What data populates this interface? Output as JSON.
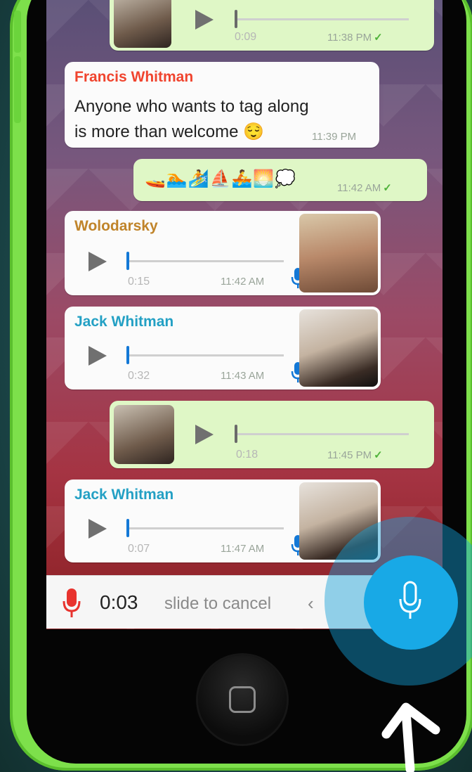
{
  "messages": [
    {
      "type": "voice",
      "direction": "out",
      "duration": "0:09",
      "time": "11:38 PM",
      "status": "✓"
    },
    {
      "type": "text",
      "direction": "in",
      "sender": "Francis Whitman",
      "sender_color": "#f0442e",
      "text_line1": "Anyone who wants to tag along",
      "text_line2": "is more than welcome 😌",
      "time": "11:39 PM"
    },
    {
      "type": "emoji",
      "direction": "out",
      "text": "🚤🏊🏄⛵🚣🌅💭",
      "time": "11:42 AM",
      "status": "✓"
    },
    {
      "type": "voice",
      "direction": "in",
      "sender": "Wolodarsky",
      "sender_color": "#c0842a",
      "duration": "0:15",
      "time": "11:42 AM"
    },
    {
      "type": "voice",
      "direction": "in",
      "sender": "Jack Whitman",
      "sender_color": "#23a0c4",
      "duration": "0:32",
      "time": "11:43 AM"
    },
    {
      "type": "voice",
      "direction": "out",
      "duration": "0:18",
      "time": "11:45 PM",
      "status": "✓"
    },
    {
      "type": "voice",
      "direction": "in",
      "sender": "Jack Whitman",
      "sender_color": "#23a0c4",
      "duration": "0:07",
      "time": "11:47 AM"
    }
  ],
  "recording": {
    "elapsed": "0:03",
    "hint": "slide to cancel",
    "chevron": "‹"
  },
  "colors": {
    "accent": "#18a9e6",
    "record_red": "#e8332e",
    "phone_green": "#7de04b"
  }
}
